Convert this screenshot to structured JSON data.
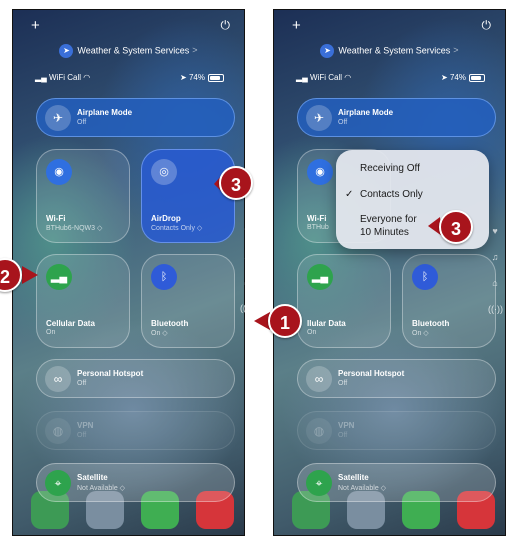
{
  "status_top": {
    "plus": "+",
    "power": "⏻"
  },
  "location": {
    "label": "Weather & System Services",
    "chevron": ">"
  },
  "status": {
    "carrier": "WiFi Call",
    "battery": "74%"
  },
  "controls": {
    "airplane": {
      "title": "Airplane Mode",
      "value": "Off"
    },
    "wifi": {
      "title": "Wi-Fi",
      "value": "BTHub6-NQW3 ◇"
    },
    "airdrop": {
      "title": "AirDrop",
      "value": "Contacts Only ◇"
    },
    "cellular": {
      "title": "Cellular Data",
      "value": "On"
    },
    "bluetooth": {
      "title": "Bluetooth",
      "value": "On ◇"
    },
    "hotspot": {
      "title": "Personal Hotspot",
      "value": "Off"
    },
    "vpn": {
      "title": "VPN",
      "value": "Off"
    },
    "satellite": {
      "title": "Satellite",
      "value": "Not Available ◇"
    }
  },
  "right_partial": {
    "wifi": "Wi-Fi",
    "wifi_value": "BTHub",
    "cellular": "llular Data"
  },
  "airdrop_menu": {
    "items": [
      "Receiving Off",
      "Contacts Only",
      "Everyone for",
      "10 Minutes"
    ],
    "check": "✓"
  },
  "callouts": {
    "one": "1",
    "two": "2",
    "three": "3"
  },
  "icons": {
    "airplane": "airplane-icon",
    "wifi": "wifi-icon",
    "airdrop": "airdrop-icon",
    "cellular": "cellular-icon",
    "bluetooth": "bluetooth-icon",
    "hotspot": "hotspot-icon",
    "vpn": "vpn-icon",
    "satellite": "satellite-icon"
  },
  "colors": {
    "callout": "#a8141c",
    "airplane_active": "#235fbe",
    "airdrop_active": "#2f5bd8",
    "cellular_green": "#2ea34d"
  }
}
